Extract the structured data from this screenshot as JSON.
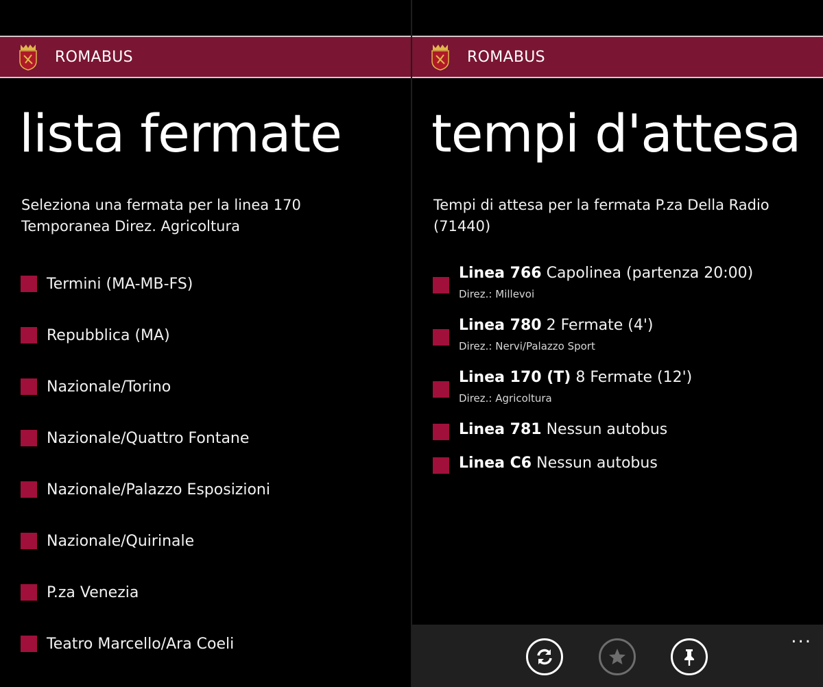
{
  "app": {
    "title": "ROMABUS"
  },
  "left": {
    "page_title": "lista fermate",
    "subtitle": "Seleziona una fermata per la linea 170 Temporanea Direz. Agricoltura",
    "stops": [
      "Termini (MA-MB-FS)",
      "Repubblica (MA)",
      "Nazionale/Torino",
      "Nazionale/Quattro Fontane",
      "Nazionale/Palazzo Esposizioni",
      "Nazionale/Quirinale",
      "P.za Venezia",
      "Teatro Marcello/Ara Coeli"
    ]
  },
  "right": {
    "page_title": "tempi d'attesa",
    "subtitle": "Tempi di attesa per la fermata P.za Della Radio (71440)",
    "arrivals": [
      {
        "line": "Linea 766",
        "status": "Capolinea (partenza 20:00)",
        "direction": "Direz.: Millevoi"
      },
      {
        "line": "Linea 780",
        "status": "2 Fermate (4')",
        "direction": "Direz.: Nervi/Palazzo Sport"
      },
      {
        "line": "Linea 170 (T)",
        "status": "8 Fermate (12')",
        "direction": "Direz.: Agricoltura"
      },
      {
        "line": "Linea 781",
        "status": "Nessun autobus",
        "direction": ""
      },
      {
        "line": "Linea C6",
        "status": "Nessun autobus",
        "direction": ""
      }
    ],
    "appbar": {
      "buttons": [
        {
          "icon": "refresh-icon",
          "enabled": true
        },
        {
          "icon": "favorite-star-icon",
          "enabled": false
        },
        {
          "icon": "pin-icon",
          "enabled": true
        }
      ],
      "more": "..."
    }
  },
  "colors": {
    "accent": "#a0103a",
    "titlebar": "#7a1533",
    "appbar": "#202020"
  }
}
